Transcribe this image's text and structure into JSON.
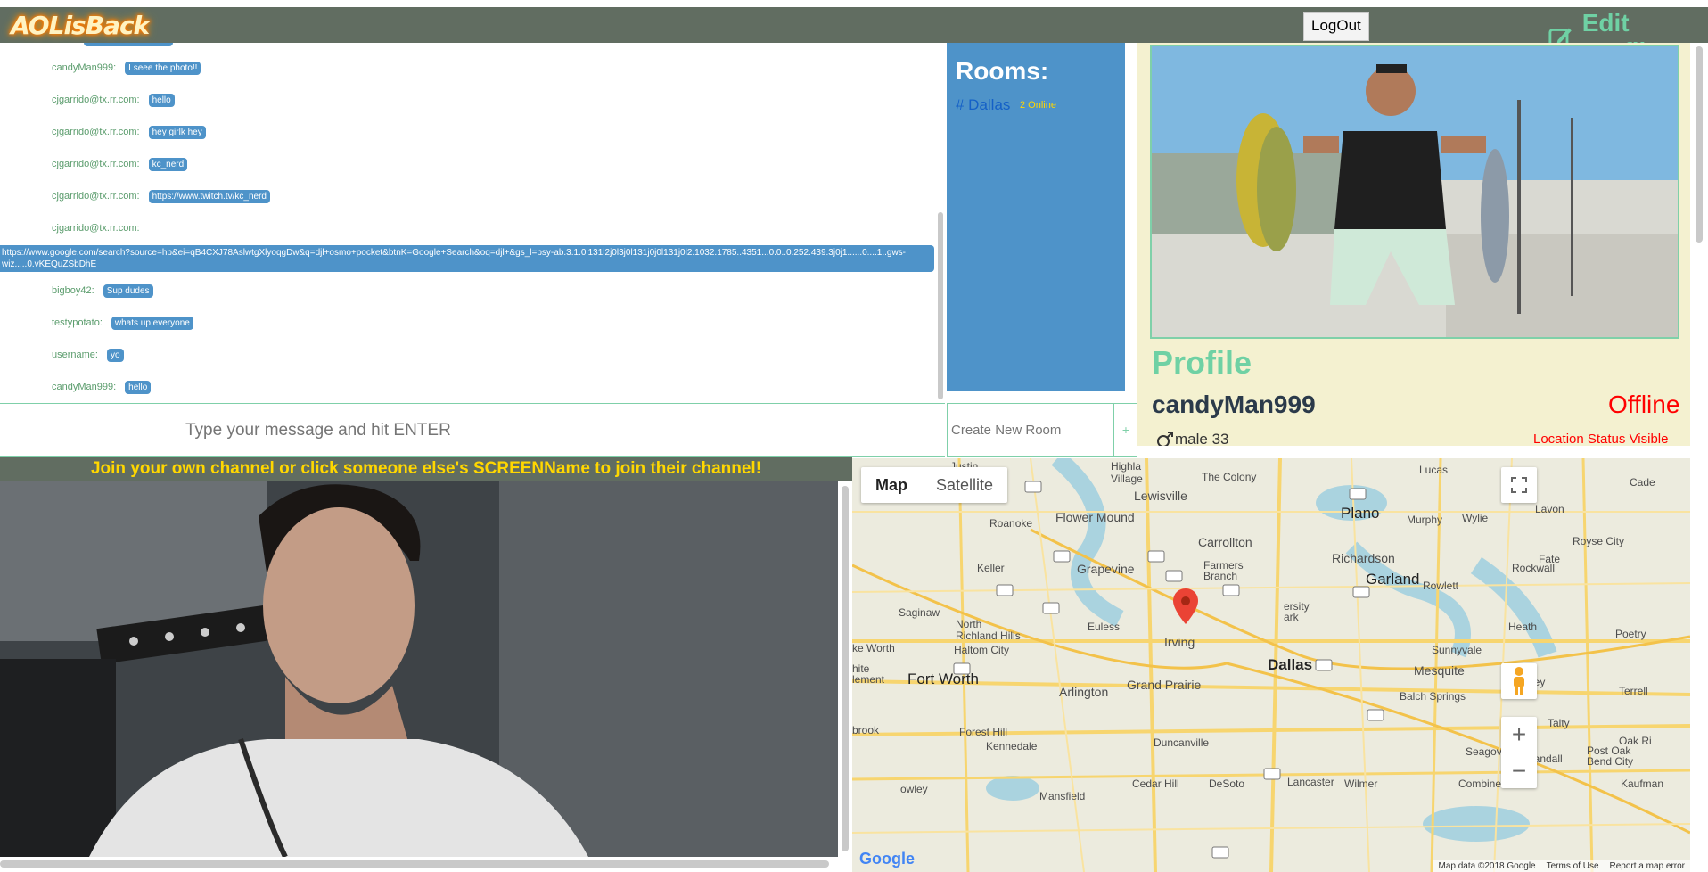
{
  "header": {
    "logo": "AOLisBack",
    "logout_label": "LogOut",
    "edit_profile_label": "Edit Profile"
  },
  "chat": {
    "messages": [
      {
        "user": "candyMan999:",
        "text": "I seee the photo!!"
      },
      {
        "user": "cjgarrido@tx.rr.com:",
        "text": "hello"
      },
      {
        "user": "cjgarrido@tx.rr.com:",
        "text": "hey girlk hey"
      },
      {
        "user": "cjgarrido@tx.rr.com:",
        "text": "kc_nerd"
      },
      {
        "user": "cjgarrido@tx.rr.com:",
        "text": "https://www.twitch.tv/kc_nerd"
      },
      {
        "user": "cjgarrido@tx.rr.com:",
        "text": ""
      },
      {
        "user": "bigboy42:",
        "text": "Sup dudes"
      },
      {
        "user": "testypotato:",
        "text": "whats up everyone"
      },
      {
        "user": "username:",
        "text": "yo"
      },
      {
        "user": "candyMan999:",
        "text": "hello"
      }
    ],
    "long_message": "https://www.google.com/search?source=hp&ei=qB4CXJ78AslwtgXlyoqgDw&q=djl+osmo+pocket&btnK=Google+Search&oq=djl+&gs_l=psy-ab.3.1.0l131l2j0l3j0l131j0j0l131j0l2.1032.1785..4351...0.0..0.252.439.3j0j1......0....1..gws-wiz.....0.vKEQuZSbDhE",
    "input_placeholder": "Type your message and hit ENTER"
  },
  "rooms": {
    "title": "Rooms:",
    "list": [
      {
        "name": "# Dallas",
        "online": "2 Online"
      }
    ],
    "new_room_placeholder": "Create New Room",
    "add_label": "+"
  },
  "profile": {
    "title": "Profile",
    "username": "candyMan999",
    "status": "Offline",
    "gender_age": "male 33",
    "location_status": "Location Status Visible"
  },
  "video": {
    "join_text": "Join your own channel or click someone else's SCREENName to join their channel!"
  },
  "map": {
    "type_buttons": [
      "Map",
      "Satellite"
    ],
    "labels": {
      "the_colony": "The Colony",
      "lewisville": "Lewisville",
      "lucas": "Lucas",
      "cade": "Cade",
      "flower_mound": "Flower Mound",
      "roanoke": "Roanoke",
      "plano": "Plano",
      "murphy": "Murphy",
      "wylie": "Wylie",
      "lavon": "Lavon",
      "carrollton": "Carrollton",
      "royse_city": "Royse City",
      "richardson": "Richardson",
      "fate": "Fate",
      "keller": "Keller",
      "grapevine": "Grapevine",
      "farmers_branch": "Farmers\nBranch",
      "garland": "Garland",
      "rockwall": "Rockwall",
      "rowlett": "Rowlett",
      "university_park": "ersity\nark",
      "saginaw": "Saginaw",
      "north_richland_hills": "North\nRichland Hills",
      "euless": "Euless",
      "heath": "Heath",
      "poetry": "Poetry",
      "haltom_city": "Haltom City",
      "irving": "Irving",
      "sunnyvale": "Sunnyvale",
      "fort_worth": "Fort Worth",
      "arlington": "Arlington",
      "grand_prairie": "Grand Prairie",
      "dallas": "Dallas",
      "mesquite": "Mesquite",
      "forney": "Forney",
      "terrell": "Terrell",
      "balch_springs": "Balch Springs",
      "forest_hill": "Forest Hill",
      "talty": "Talty",
      "kennedale": "Kennedale",
      "duncanville": "Duncanville",
      "seagoville": "Seagoville",
      "oak_ridge": "Oak Ri",
      "post_oak_bend": "Post Oak\nBend City",
      "crandall": "Crandall",
      "cedar_hill": "Cedar Hill",
      "desoto": "DeSoto",
      "lancaster": "Lancaster",
      "wilmer": "Wilmer",
      "combine": "Combine",
      "kaufman": "Kaufman",
      "mansfield": "Mansfield",
      "rowley": "owley",
      "benbrook": "brook",
      "white_settlement": "hite\nlement",
      "lake_worth": "ke Worth",
      "village": "Village",
      "justin": "Justin",
      "highland": "Highla"
    },
    "footer": [
      "Map data ©2018 Google",
      "Terms of Use",
      "Report a map error"
    ],
    "google_logo": "Google",
    "zoom_in": "+",
    "zoom_out": "−"
  }
}
